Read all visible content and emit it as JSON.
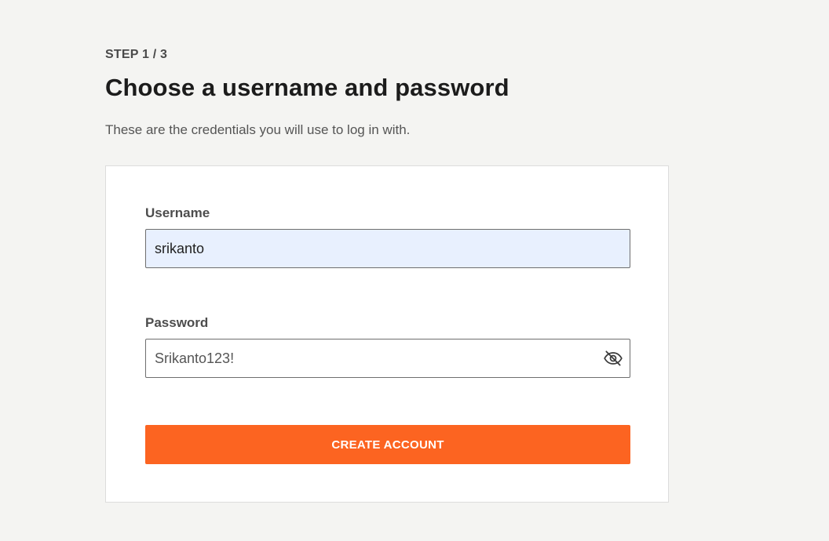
{
  "header": {
    "step": "STEP 1 / 3",
    "title": "Choose a username and password",
    "subtitle": "These are the credentials you will use to log in with."
  },
  "form": {
    "username": {
      "label": "Username",
      "value": "srikanto"
    },
    "password": {
      "label": "Password",
      "value": "Srikanto123!",
      "visibility_icon": "eye-slash-icon"
    },
    "submit_label": "CREATE ACCOUNT"
  },
  "colors": {
    "page_background": "#f4f4f2",
    "accent": "#fc6421",
    "autofill_background": "#e8f0fe"
  }
}
